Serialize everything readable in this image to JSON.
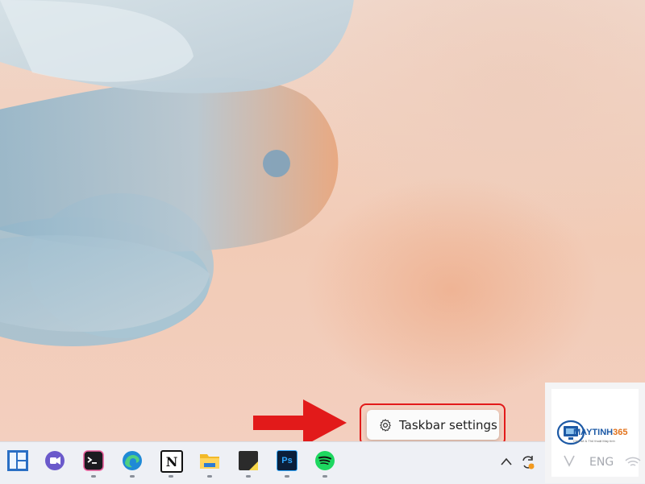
{
  "context_menu": {
    "taskbar_settings_label": "Taskbar settings"
  },
  "taskbar": {
    "apps": [
      {
        "name": "start-icon"
      },
      {
        "name": "teams-icon"
      },
      {
        "name": "terminal-icon"
      },
      {
        "name": "edge-icon"
      },
      {
        "name": "notion-icon",
        "glyph": "N"
      },
      {
        "name": "file-explorer-icon"
      },
      {
        "name": "sticky-notes-icon"
      },
      {
        "name": "photoshop-icon",
        "glyph": "Ps"
      },
      {
        "name": "spotify-icon"
      }
    ],
    "tray": {
      "chevron": "^",
      "language": "ENG"
    }
  },
  "watermark": {
    "brand_main": "MAYTINH",
    "brand_num": "365",
    "tagline": "Chia sẻ & Thủ thuật Máy tính"
  },
  "colors": {
    "highlight": "#e21a1a",
    "taskbar": "#eef0f5",
    "arrow": "#e21a1a"
  }
}
